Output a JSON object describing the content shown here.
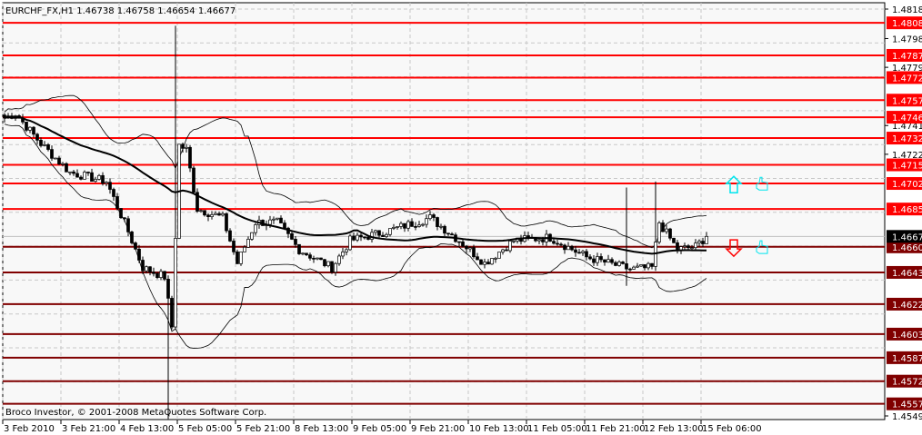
{
  "header": {
    "symbol": "EURCHF_FX,H1",
    "open": "1.46738",
    "high": "1.46758",
    "low": "1.46654",
    "close": "1.46677"
  },
  "copyright": "Broco Investor, © 2001-2008 MetaQuotes Software Corp.",
  "colors": {
    "resistance": "#ff0000",
    "support": "#800000",
    "arrow_up": "#00e5ee",
    "arrow_down": "#ff0000",
    "thumb": "#00e5ee"
  },
  "chart_data": {
    "type": "candlestick",
    "title": "EURCHF_FX,H1",
    "ylim": [
      1.4549,
      1.4818
    ],
    "y_ticks": [
      "1.48180",
      "1.47985",
      "1.47795",
      "1.47410",
      "1.47220",
      "1.45490"
    ],
    "current_price": "1.46677",
    "x_ticks": [
      "3 Feb 2010",
      "3 Feb 21:00",
      "4 Feb 13:00",
      "5 Feb 05:00",
      "5 Feb 21:00",
      "8 Feb 13:00",
      "9 Feb 05:00",
      "9 Feb 21:00",
      "10 Feb 13:00",
      "11 Feb 05:00",
      "11 Feb 21:00",
      "12 Feb 13:00",
      "15 Feb 06:00"
    ],
    "bars_per_tick": 16,
    "resistance_levels": [
      "1.48089",
      "1.47874",
      "1.47727",
      "1.47578",
      "1.47465",
      "1.47327",
      "1.47150",
      "1.47027",
      "1.46858"
    ],
    "support_levels": [
      "1.46608",
      "1.46439",
      "1.46229",
      "1.46031",
      "1.45875",
      "1.45720",
      "1.45570"
    ],
    "close_path": [
      [
        0,
        1.4746
      ],
      [
        3,
        1.4749
      ],
      [
        10,
        1.4729
      ],
      [
        18,
        1.471
      ],
      [
        28,
        1.4704
      ],
      [
        34,
        1.4671
      ],
      [
        38,
        1.4647
      ],
      [
        44,
        1.4641
      ],
      [
        46,
        1.4608
      ],
      [
        48,
        1.4728
      ],
      [
        50,
        1.4725
      ],
      [
        53,
        1.4686
      ],
      [
        60,
        1.468
      ],
      [
        64,
        1.465
      ],
      [
        69,
        1.4677
      ],
      [
        75,
        1.4677
      ],
      [
        81,
        1.4659
      ],
      [
        90,
        1.4647
      ],
      [
        95,
        1.4665
      ],
      [
        105,
        1.4671
      ],
      [
        117,
        1.468
      ],
      [
        125,
        1.4665
      ],
      [
        132,
        1.465
      ],
      [
        140,
        1.4665
      ],
      [
        150,
        1.4667
      ],
      [
        160,
        1.4654
      ],
      [
        172,
        1.4646
      ],
      [
        178,
        1.4647
      ],
      [
        180,
        1.4677
      ],
      [
        185,
        1.4659
      ],
      [
        190,
        1.4661
      ],
      [
        193,
        1.46677
      ]
    ],
    "spikes": [
      {
        "bar": 45,
        "low": 1.4547
      },
      {
        "bar": 47,
        "high": 1.4807
      },
      {
        "bar": 171,
        "high": 1.47,
        "low": 1.4635
      },
      {
        "bar": 179,
        "high": 1.4704
      }
    ],
    "indicators": [
      "Bollinger Bands (20, 2)",
      "Moving Average (50)"
    ],
    "signals": [
      {
        "type": "arrow-up",
        "price": 1.4702
      },
      {
        "type": "arrow-down",
        "price": 1.466
      }
    ]
  }
}
